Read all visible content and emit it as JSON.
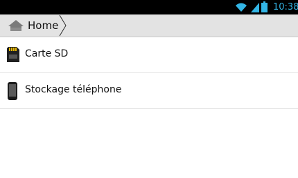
{
  "status_bar": {
    "time": "10:38",
    "time_color": "#33b5e5",
    "icons": [
      "wifi-icon",
      "signal-icon",
      "battery-icon"
    ]
  },
  "breadcrumb": {
    "home_icon": "home-icon",
    "home_label": "Home"
  },
  "storage_list": {
    "items": [
      {
        "label": "Carte SD",
        "icon": "sd-card-icon"
      },
      {
        "label": "Stockage téléphone",
        "icon": "phone-icon"
      }
    ]
  }
}
